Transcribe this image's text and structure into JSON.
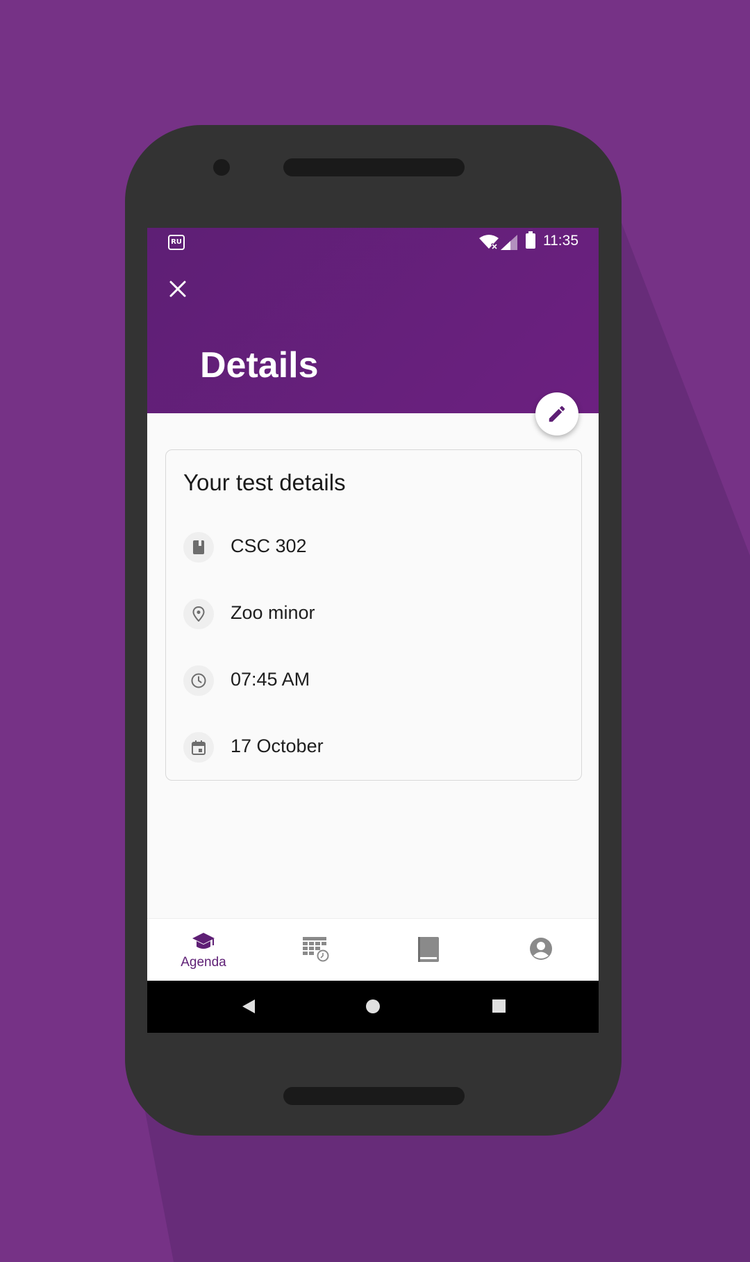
{
  "status_bar": {
    "carrier_badge": "RU",
    "time": "11:35"
  },
  "header": {
    "title": "Details"
  },
  "card": {
    "title": "Your test details",
    "rows": [
      {
        "icon": "book-icon",
        "text": "CSC 302"
      },
      {
        "icon": "location-pin-icon",
        "text": "Zoo minor"
      },
      {
        "icon": "clock-icon",
        "text": "07:45 AM"
      },
      {
        "icon": "calendar-icon",
        "text": "17 October"
      }
    ]
  },
  "bottom_nav": {
    "items": [
      {
        "icon": "graduation-cap-icon",
        "label": "Agenda",
        "active": true
      },
      {
        "icon": "timetable-icon",
        "label": ""
      },
      {
        "icon": "book-icon",
        "label": ""
      },
      {
        "icon": "account-circle-icon",
        "label": ""
      }
    ]
  },
  "colors": {
    "primary": "#6a1f7e",
    "background": "#763286",
    "icon_grey": "#757575"
  }
}
